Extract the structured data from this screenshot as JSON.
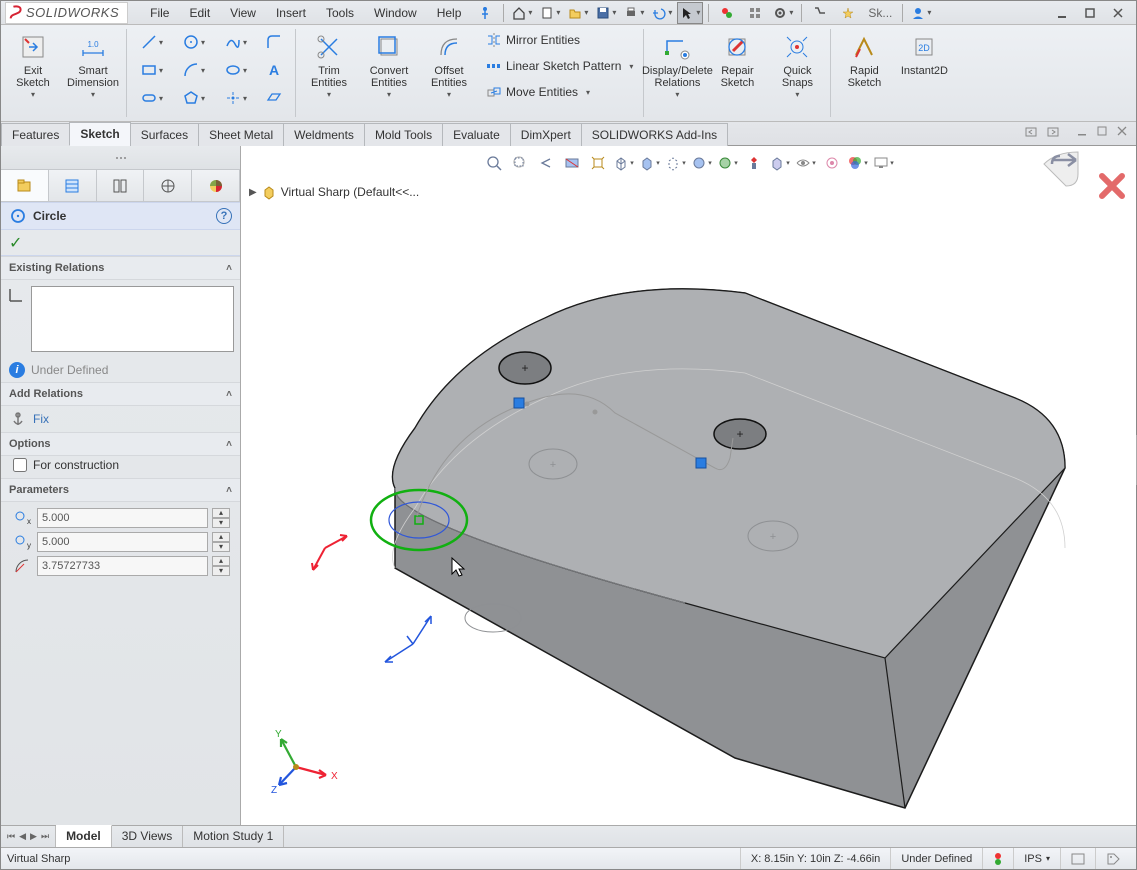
{
  "app": {
    "name_prefix": "SOLID",
    "name_suffix": "WORKS"
  },
  "menu": [
    "File",
    "Edit",
    "View",
    "Insert",
    "Tools",
    "Window",
    "Help"
  ],
  "quick_icons": {
    "search_label": "Sk..."
  },
  "ribbon": {
    "exit_sketch": "Exit Sketch",
    "smart_dimension": "Smart Dimension",
    "trim": "Trim Entities",
    "convert": "Convert Entities",
    "offset": "Offset Entities",
    "mirror": "Mirror Entities",
    "linear_pattern": "Linear Sketch Pattern",
    "move": "Move Entities",
    "display_delete": "Display/Delete Relations",
    "repair": "Repair Sketch",
    "quick_snaps": "Quick Snaps",
    "rapid": "Rapid Sketch",
    "instant2d": "Instant2D"
  },
  "main_tabs": [
    "Features",
    "Sketch",
    "Surfaces",
    "Sheet Metal",
    "Weldments",
    "Mold Tools",
    "Evaluate",
    "DimXpert",
    "SOLIDWORKS Add-Ins"
  ],
  "main_tab_active": "Sketch",
  "property_manager": {
    "title": "Circle",
    "existing_relations_head": "Existing Relations",
    "under_defined": "Under Defined",
    "add_relations_head": "Add Relations",
    "fix": "Fix",
    "options_head": "Options",
    "for_construction": "For construction",
    "parameters_head": "Parameters",
    "cx": "5.000",
    "cy": "5.000",
    "radius": "3.75727733"
  },
  "graphics": {
    "doc_tree": "Virtual Sharp  (Default<<..."
  },
  "doc_tabs": [
    "Model",
    "3D Views",
    "Motion Study 1"
  ],
  "doc_tab_active": "Model",
  "status": {
    "left": "Virtual Sharp",
    "coords": "X: 8.15in Y: 10in Z: -4.66in",
    "defined": "Under Defined",
    "units": "IPS"
  }
}
